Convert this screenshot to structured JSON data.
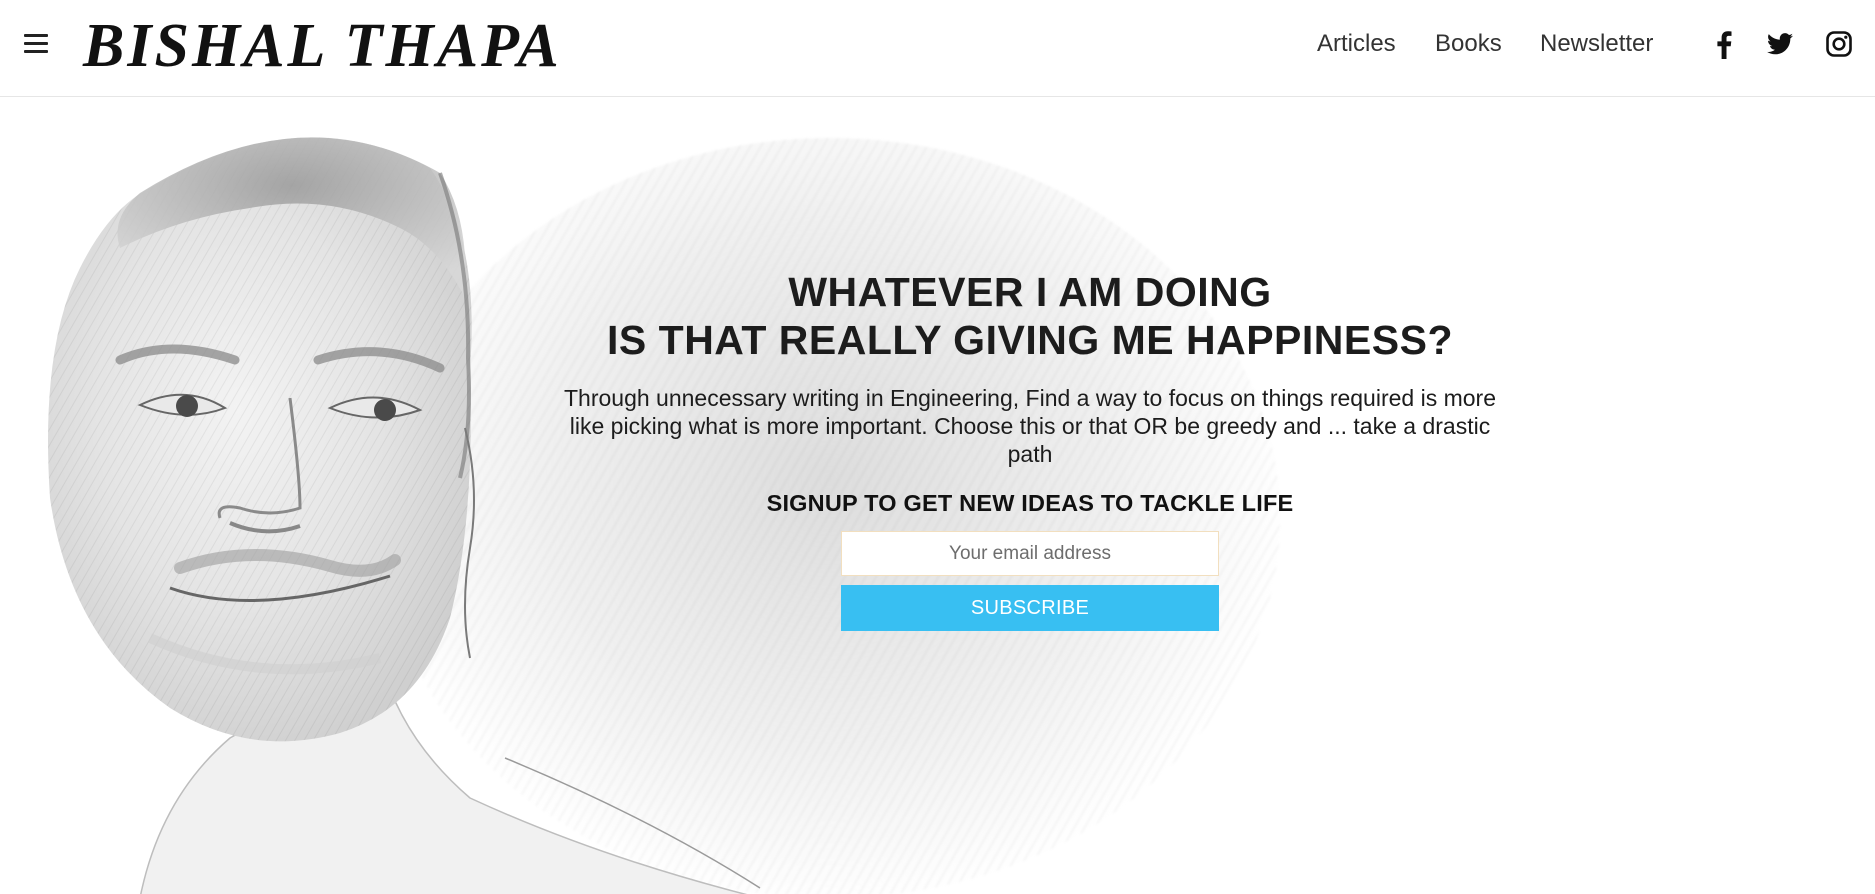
{
  "header": {
    "menu_icon": "hamburger-menu-icon",
    "logo": "BISHAL THAPA",
    "nav": [
      {
        "label": "Articles"
      },
      {
        "label": "Books"
      },
      {
        "label": "Newsletter"
      }
    ],
    "social": [
      {
        "icon": "facebook-icon"
      },
      {
        "icon": "twitter-icon"
      },
      {
        "icon": "instagram-icon"
      }
    ]
  },
  "hero": {
    "headline_line1": "WHATEVER I AM DOING",
    "headline_line2": "IS THAT REALLY GIVING ME HAPPINESS?",
    "lead": "Through unnecessary writing in Engineering, Find a way to focus on things required is more like picking what is more important. Choose this or that OR be greedy and ... take a drastic path",
    "signup_title": "SIGNUP TO GET NEW IDEAS TO TACKLE LIFE",
    "email_placeholder": "Your email address",
    "subscribe_label": "SUBSCRIBE",
    "button_color": "#38bff2"
  }
}
